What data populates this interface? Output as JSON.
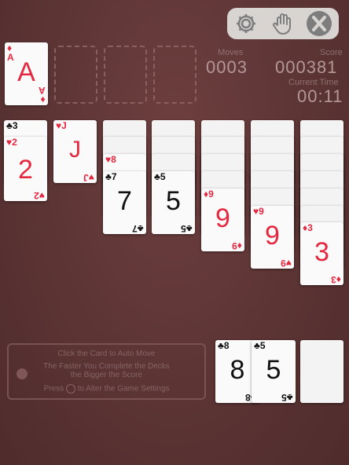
{
  "toolbar": {
    "icons": [
      "gear-icon",
      "hand-icon",
      "close-icon"
    ]
  },
  "stats": {
    "moves_label": "Moves",
    "moves": "0003",
    "score_label": "Score",
    "score": "000381",
    "time_label": "Current Time",
    "time": "00:11"
  },
  "foundation": {
    "card": {
      "rank": "A",
      "suit": "♦",
      "color": "red"
    }
  },
  "tableau": [
    {
      "cards": [
        {
          "rank": "3",
          "suit": "♣"
        },
        {
          "rank": "2",
          "suit": "♥"
        }
      ]
    },
    {
      "cards": [
        {
          "rank": "J",
          "suit": "♥"
        }
      ]
    },
    {
      "cards": [
        {
          "rank": "8",
          "suit": "♥"
        },
        {
          "rank": "7",
          "suit": "♣"
        }
      ]
    },
    {
      "cards": [
        {
          "rank": "5",
          "suit": "♣"
        }
      ]
    },
    {
      "cards": [
        {
          "rank": "9",
          "suit": "♦"
        }
      ]
    },
    {
      "cards": [
        {
          "rank": "9",
          "suit": "♥"
        }
      ]
    },
    {
      "cards": [
        {
          "rank": "3",
          "suit": "♦"
        }
      ]
    }
  ],
  "waste": [
    {
      "rank": "8",
      "suit": "♣"
    },
    {
      "rank": "5",
      "suit": "♣"
    }
  ],
  "hints": {
    "line1": "Click the Card to Auto Move",
    "line2": "The Faster You Complete the Decks",
    "line3": "the Bigger the Score",
    "line4_before": "Press",
    "line4_after": "to Alter the Game Settings"
  },
  "colors": {
    "felt": "#5c3434",
    "red": "#e5283f",
    "black": "#111111"
  }
}
